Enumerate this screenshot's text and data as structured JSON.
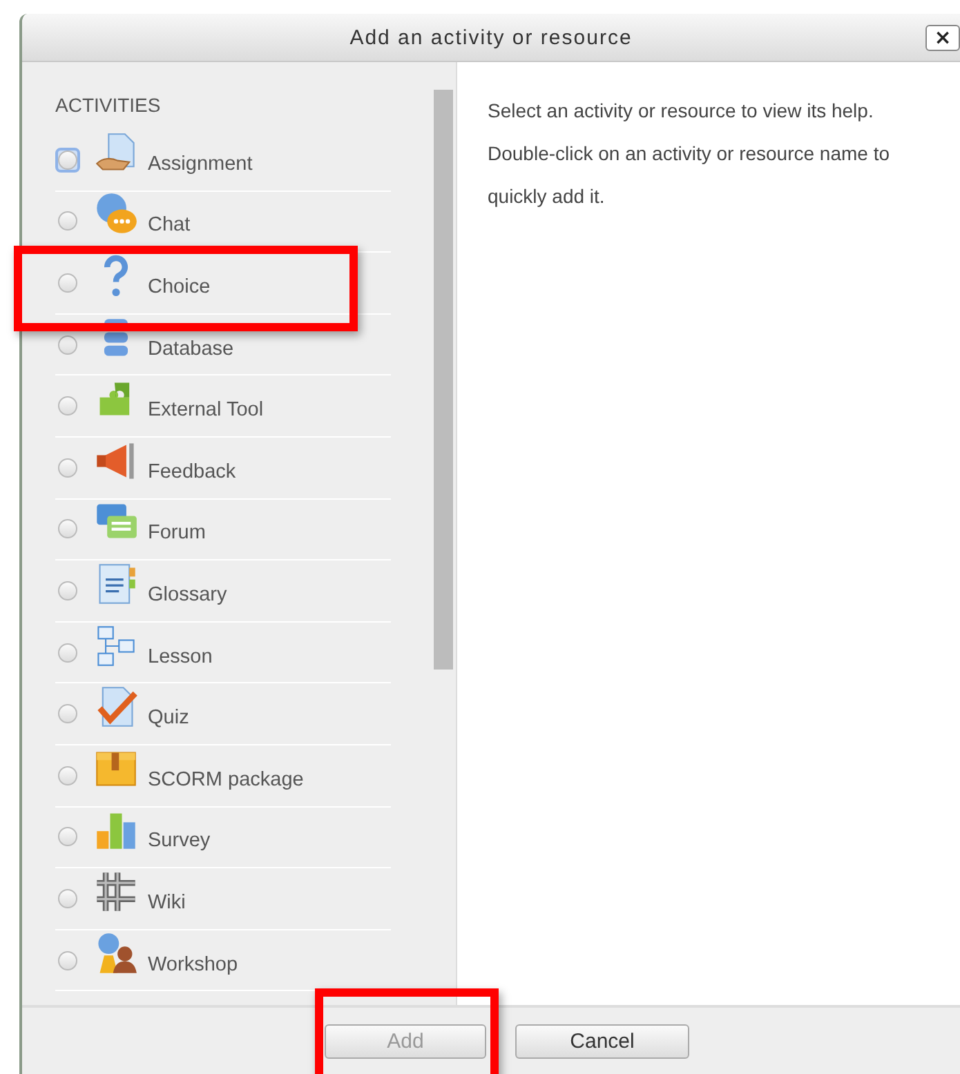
{
  "dialog": {
    "title": "Add an activity or resource",
    "close": "×"
  },
  "activities": {
    "heading": "ACTIVITIES",
    "items": [
      {
        "label": "Assignment",
        "selected": false,
        "focused": true
      },
      {
        "label": "Chat",
        "selected": false,
        "focused": false
      },
      {
        "label": "Choice",
        "selected": false,
        "focused": false
      },
      {
        "label": "Database",
        "selected": false,
        "focused": false
      },
      {
        "label": "External Tool",
        "selected": false,
        "focused": false
      },
      {
        "label": "Feedback",
        "selected": false,
        "focused": false
      },
      {
        "label": "Forum",
        "selected": false,
        "focused": false
      },
      {
        "label": "Glossary",
        "selected": false,
        "focused": false
      },
      {
        "label": "Lesson",
        "selected": false,
        "focused": false
      },
      {
        "label": "Quiz",
        "selected": false,
        "focused": false
      },
      {
        "label": "SCORM package",
        "selected": false,
        "focused": false
      },
      {
        "label": "Survey",
        "selected": false,
        "focused": false
      },
      {
        "label": "Wiki",
        "selected": false,
        "focused": false
      },
      {
        "label": "Workshop",
        "selected": false,
        "focused": false
      }
    ]
  },
  "help": [
    "Select an activity or resource to view its help.",
    "Double-click on an activity or resource name to quickly add it."
  ],
  "buttons": [
    {
      "label": "Add",
      "disabled": true
    },
    {
      "label": "Cancel",
      "disabled": false
    }
  ]
}
